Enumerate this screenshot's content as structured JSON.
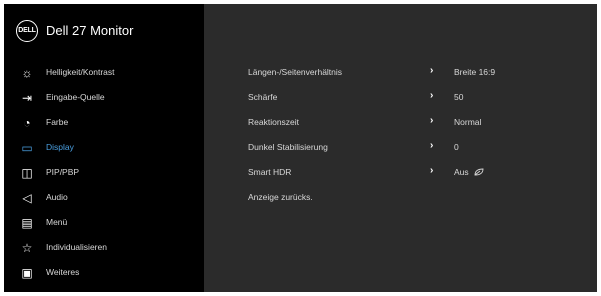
{
  "header": {
    "logo": "DELL",
    "title": "Dell 27 Monitor"
  },
  "menu": [
    {
      "label": "Helligkeit/Kontrast",
      "icon": "brightness-icon"
    },
    {
      "label": "Eingabe-Quelle",
      "icon": "input-source-icon"
    },
    {
      "label": "Farbe",
      "icon": "color-palette-icon"
    },
    {
      "label": "Display",
      "icon": "display-icon",
      "active": true
    },
    {
      "label": "PIP/PBP",
      "icon": "pip-pbp-icon"
    },
    {
      "label": "Audio",
      "icon": "speaker-icon"
    },
    {
      "label": "Menü",
      "icon": "menu-icon"
    },
    {
      "label": "Individualisieren",
      "icon": "star-icon"
    },
    {
      "label": "Weiteres",
      "icon": "info-icon"
    }
  ],
  "settings": [
    {
      "label": "Längen-/Seitenverhältnis",
      "value": "Breite 16:9"
    },
    {
      "label": "Schärfe",
      "value": "50"
    },
    {
      "label": "Reaktionszeit",
      "value": "Normal"
    },
    {
      "label": "Dunkel Stabilisierung",
      "value": "0"
    },
    {
      "label": "Smart HDR",
      "value": "Aus",
      "value_icon": "leaf-icon"
    },
    {
      "label": "Anzeige zurücks."
    }
  ],
  "colors": {
    "active": "#4a9fe0",
    "sidebar_bg": "#000000",
    "panel_bg": "#2b2b2b"
  }
}
